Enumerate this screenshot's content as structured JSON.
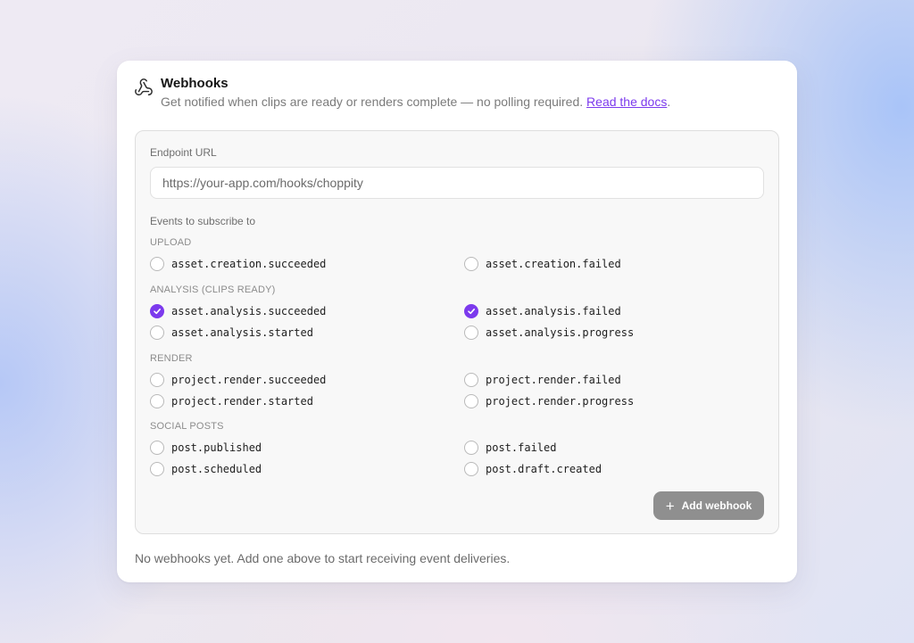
{
  "header": {
    "title": "Webhooks",
    "subtitle": "Get notified when clips are ready or renders complete — no polling required.",
    "docs_link": "Read the docs",
    "subtitle_end": "."
  },
  "form": {
    "endpoint_label": "Endpoint URL",
    "endpoint_placeholder": "https://your-app.com/hooks/choppity",
    "endpoint_value": "",
    "events_label": "Events to subscribe to",
    "add_button": "Add webhook"
  },
  "groups": [
    {
      "label": "UPLOAD",
      "events": [
        {
          "name": "asset.creation.succeeded",
          "checked": false
        },
        {
          "name": "asset.creation.failed",
          "checked": false
        }
      ]
    },
    {
      "label": "ANALYSIS (CLIPS READY)",
      "events": [
        {
          "name": "asset.analysis.succeeded",
          "checked": true
        },
        {
          "name": "asset.analysis.failed",
          "checked": true
        },
        {
          "name": "asset.analysis.started",
          "checked": false
        },
        {
          "name": "asset.analysis.progress",
          "checked": false
        }
      ]
    },
    {
      "label": "RENDER",
      "events": [
        {
          "name": "project.render.succeeded",
          "checked": false
        },
        {
          "name": "project.render.failed",
          "checked": false
        },
        {
          "name": "project.render.started",
          "checked": false
        },
        {
          "name": "project.render.progress",
          "checked": false
        }
      ]
    },
    {
      "label": "SOCIAL POSTS",
      "events": [
        {
          "name": "post.published",
          "checked": false
        },
        {
          "name": "post.failed",
          "checked": false
        },
        {
          "name": "post.scheduled",
          "checked": false
        },
        {
          "name": "post.draft.created",
          "checked": false
        }
      ]
    }
  ],
  "empty_state": "No webhooks yet. Add one above to start receiving event deliveries.",
  "colors": {
    "accent": "#7c3aed",
    "button_disabled": "#8f8f8f"
  },
  "icons": {
    "header": "webhook-icon",
    "checkbox_checked": "check-icon",
    "add_button": "plus-icon"
  }
}
